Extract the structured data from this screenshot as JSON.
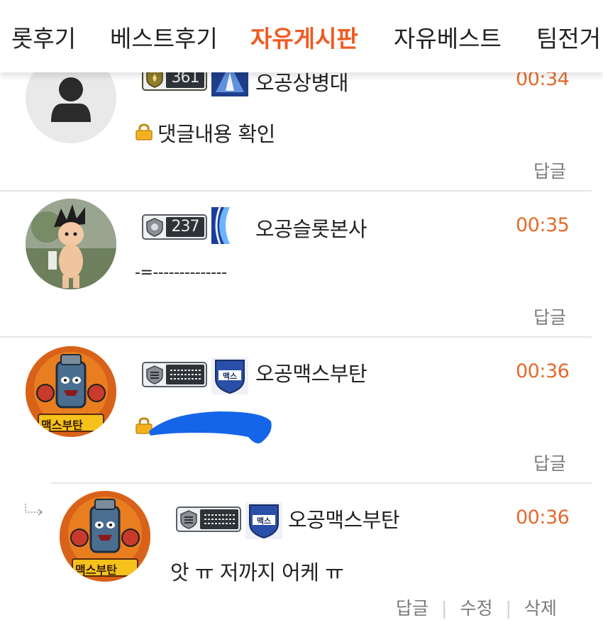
{
  "tabs": [
    {
      "label": "롯후기",
      "active": false
    },
    {
      "label": "베스트후기",
      "active": false
    },
    {
      "label": "자유게시판",
      "active": true
    },
    {
      "label": "자유베스트",
      "active": false
    },
    {
      "label": "팀전거",
      "active": false
    }
  ],
  "colors": {
    "accent": "#f05a22",
    "time": "#e46a2c",
    "muted": "#7b7b7b"
  },
  "comments": [
    {
      "badge_level": "361",
      "nickname": "오공상병대",
      "time": "00:34",
      "content": "댓글내용 확인",
      "locked": true,
      "reply_label": "답글"
    },
    {
      "badge_level": "237",
      "nickname": "오공슬롯본사",
      "time": "00:35",
      "content": "-=--------------",
      "locked": false,
      "reply_label": "답글"
    },
    {
      "badge_level": "",
      "nickname": "오공맥스부탄",
      "time": "00:36",
      "content": "",
      "locked": true,
      "avatar_label": "맥스부탄",
      "emblem_label": "맥스",
      "reply_label": "답글"
    },
    {
      "badge_level": "",
      "nickname": "오공맥스부탄",
      "time": "00:36",
      "content": "앗 ㅠ 저까지 어케 ㅠ",
      "locked": false,
      "avatar_label": "맥스부탄",
      "emblem_label": "맥스",
      "reply_label": "답글",
      "edit_label": "수정",
      "delete_label": "삭제"
    }
  ]
}
